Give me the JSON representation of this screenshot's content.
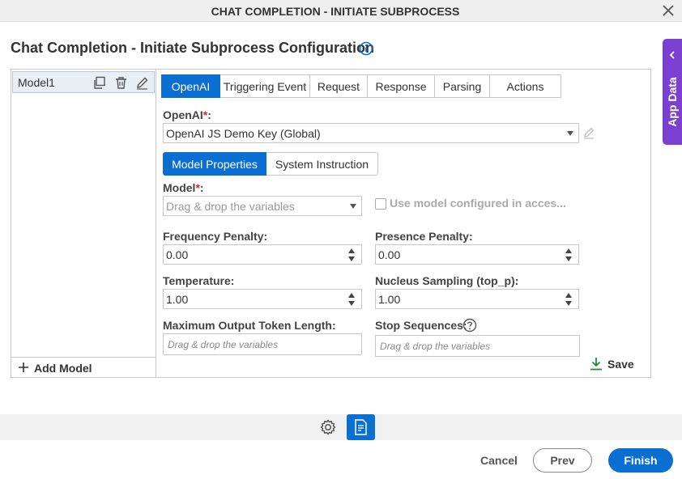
{
  "dialog": {
    "title": "CHAT COMPLETION - INITIATE SUBPROCESS",
    "config_title": "Chat Completion - Initiate Subprocess Configuration"
  },
  "app_data_panel": {
    "label": "App Data"
  },
  "models": {
    "items": [
      {
        "name": "Model1"
      }
    ],
    "add_label": "Add Model"
  },
  "tabs": [
    {
      "label": "OpenAI",
      "active": true
    },
    {
      "label": "Triggering Event"
    },
    {
      "label": "Request"
    },
    {
      "label": "Response"
    },
    {
      "label": "Parsing"
    },
    {
      "label": "Actions"
    }
  ],
  "openai": {
    "label": "OpenAI",
    "required_mark": "*",
    "label_suffix": ":",
    "selected": "OpenAI JS Demo Key (Global)"
  },
  "subtabs": [
    {
      "label": "Model Properties",
      "active": true
    },
    {
      "label": "System Instruction"
    }
  ],
  "model": {
    "label": "Model",
    "required_mark": "*",
    "label_suffix": ":",
    "placeholder": "Drag & drop the variables",
    "use_configured_label": "Use model configured in acces..."
  },
  "fields": {
    "frequency_penalty": {
      "label": "Frequency Penalty:",
      "value": "0.00"
    },
    "presence_penalty": {
      "label": "Presence Penalty:",
      "value": "0.00"
    },
    "temperature": {
      "label": "Temperature:",
      "value": "1.00"
    },
    "nucleus_sampling": {
      "label": "Nucleus Sampling (top_p):",
      "value": "1.00"
    },
    "max_output_tokens": {
      "label": "Maximum Output Token Length:",
      "placeholder": "Drag & drop the variables"
    },
    "stop_sequences": {
      "label": "Stop Sequences:",
      "placeholder": "Drag & drop the variables"
    }
  },
  "save_label": "Save",
  "footer": {
    "cancel": "Cancel",
    "prev": "Prev",
    "finish": "Finish"
  },
  "colors": {
    "accent": "#0a6fd1",
    "app_data": "#7b3fd1",
    "required": "#dd2222",
    "save_icon": "#1e8a3c"
  }
}
